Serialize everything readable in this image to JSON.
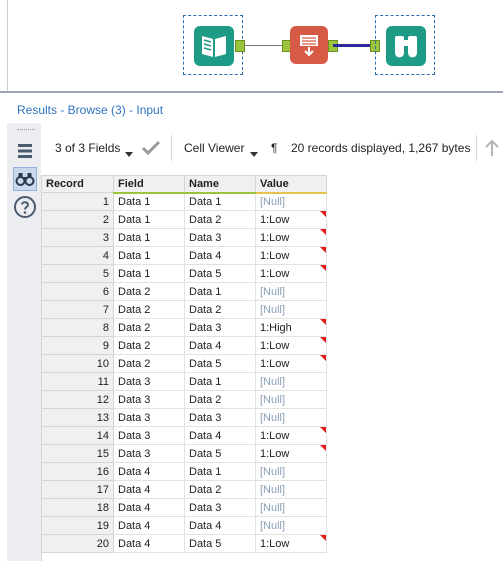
{
  "results": {
    "title": "Results - Browse (3) - Input"
  },
  "toolbar": {
    "fields_label": "3 of 3 Fields",
    "viewer_label": "Cell Viewer",
    "pilcrow": "¶",
    "status": "20 records displayed, 1,267 bytes"
  },
  "table": {
    "headers": [
      "Record",
      "Field",
      "Name",
      "Value"
    ],
    "rows": [
      {
        "record": "1",
        "field": "Data 1",
        "name": "Data 1",
        "value": "[Null]",
        "is_null": true
      },
      {
        "record": "2",
        "field": "Data 1",
        "name": "Data 2",
        "value": "1:Low",
        "is_null": false
      },
      {
        "record": "3",
        "field": "Data 1",
        "name": "Data 3",
        "value": "1:Low",
        "is_null": false
      },
      {
        "record": "4",
        "field": "Data 1",
        "name": "Data 4",
        "value": "1:Low",
        "is_null": false
      },
      {
        "record": "5",
        "field": "Data 1",
        "name": "Data 5",
        "value": "1:Low",
        "is_null": false
      },
      {
        "record": "6",
        "field": "Data 2",
        "name": "Data 1",
        "value": "[Null]",
        "is_null": true
      },
      {
        "record": "7",
        "field": "Data 2",
        "name": "Data 2",
        "value": "[Null]",
        "is_null": true
      },
      {
        "record": "8",
        "field": "Data 2",
        "name": "Data 3",
        "value": "1:High",
        "is_null": false
      },
      {
        "record": "9",
        "field": "Data 2",
        "name": "Data 4",
        "value": "1:Low",
        "is_null": false
      },
      {
        "record": "10",
        "field": "Data 2",
        "name": "Data 5",
        "value": "1:Low",
        "is_null": false
      },
      {
        "record": "11",
        "field": "Data 3",
        "name": "Data 1",
        "value": "[Null]",
        "is_null": true
      },
      {
        "record": "12",
        "field": "Data 3",
        "name": "Data 2",
        "value": "[Null]",
        "is_null": true
      },
      {
        "record": "13",
        "field": "Data 3",
        "name": "Data 3",
        "value": "[Null]",
        "is_null": true
      },
      {
        "record": "14",
        "field": "Data 3",
        "name": "Data 4",
        "value": "1:Low",
        "is_null": false
      },
      {
        "record": "15",
        "field": "Data 3",
        "name": "Data 5",
        "value": "1:Low",
        "is_null": false
      },
      {
        "record": "16",
        "field": "Data 4",
        "name": "Data 1",
        "value": "[Null]",
        "is_null": true
      },
      {
        "record": "17",
        "field": "Data 4",
        "name": "Data 2",
        "value": "[Null]",
        "is_null": true
      },
      {
        "record": "18",
        "field": "Data 4",
        "name": "Data 3",
        "value": "[Null]",
        "is_null": true
      },
      {
        "record": "19",
        "field": "Data 4",
        "name": "Data 4",
        "value": "[Null]",
        "is_null": true
      },
      {
        "record": "20",
        "field": "Data 4",
        "name": "Data 5",
        "value": "1:Low",
        "is_null": false
      }
    ]
  },
  "icons": {
    "input_tool": "book-input-icon",
    "transform_tool": "transpose-tool-icon",
    "browse_tool": "binoculars-icon",
    "strip": [
      "list-view-icon",
      "binoculars-icon",
      "help-icon"
    ],
    "toolbar": [
      "dropdown-arrow-icon",
      "checkmark-icon",
      "dropdown-arrow-icon",
      "up-arrow-icon"
    ]
  },
  "colors": {
    "input_tool": "#1e9b86",
    "transform_tool": "#d65a45",
    "anchor": "#9bc33b",
    "link_title": "#2f74c0",
    "null_text": "#8a9fb8",
    "modified_marker": "#e31b1b"
  }
}
